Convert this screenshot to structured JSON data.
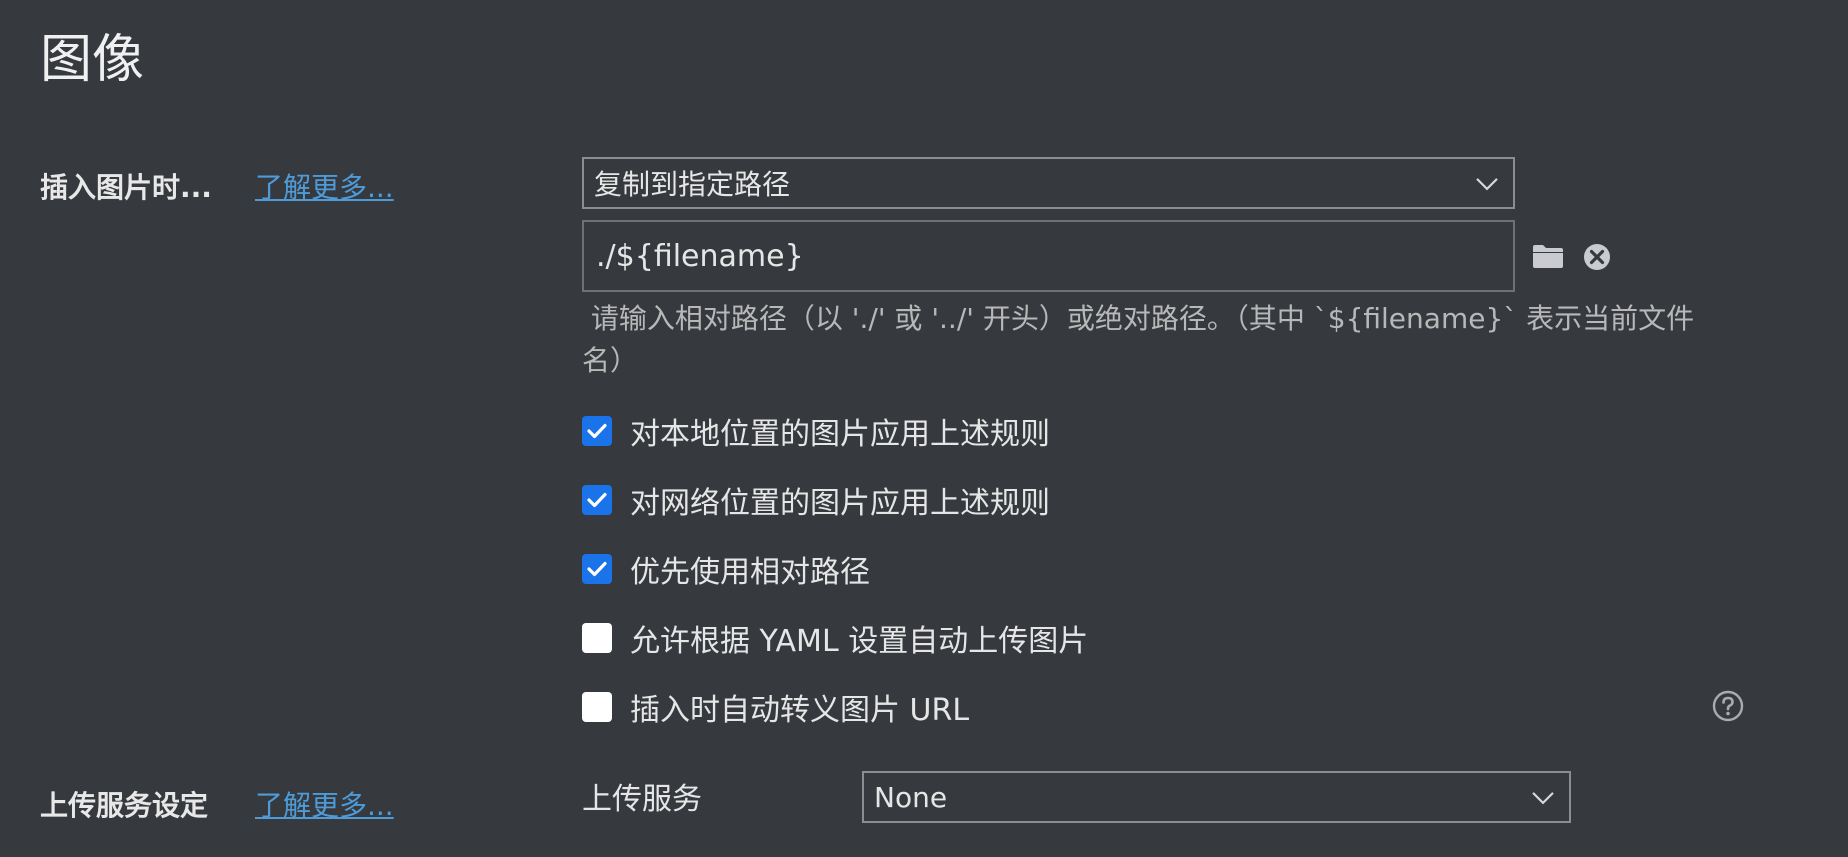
{
  "page_title": "图像",
  "insert_section": {
    "label": "插入图片时...",
    "learn_more": "了解更多...",
    "action_select": {
      "value": "复制到指定路径",
      "icon": "chevron-down-icon"
    },
    "path_input": {
      "value": "./${filename}"
    },
    "folder_icon": "folder-icon",
    "clear_icon": "close-circle-icon",
    "hint_line1": " 请输入相对路径（以 './' 或 '../' 开头）或绝对路径。（其中 `${filename}` 表示当前文件",
    "hint_line2": "名）",
    "options": [
      {
        "label": "对本地位置的图片应用上述规则",
        "checked": true
      },
      {
        "label": "对网络位置的图片应用上述规则",
        "checked": true
      },
      {
        "label": "优先使用相对路径",
        "checked": true
      },
      {
        "label": "允许根据 YAML 设置自动上传图片",
        "checked": false
      },
      {
        "label": "插入时自动转义图片 URL",
        "checked": false
      }
    ],
    "help_icon": "help-circle-icon"
  },
  "upload_section": {
    "label": "上传服务设定",
    "learn_more": "了解更多...",
    "service_label": "上传服务",
    "service_select": {
      "value": "None",
      "icon": "chevron-down-icon"
    }
  },
  "colors": {
    "background": "#363a3f",
    "link": "#4e9bd8",
    "checkbox_checked": "#1a73e8"
  }
}
